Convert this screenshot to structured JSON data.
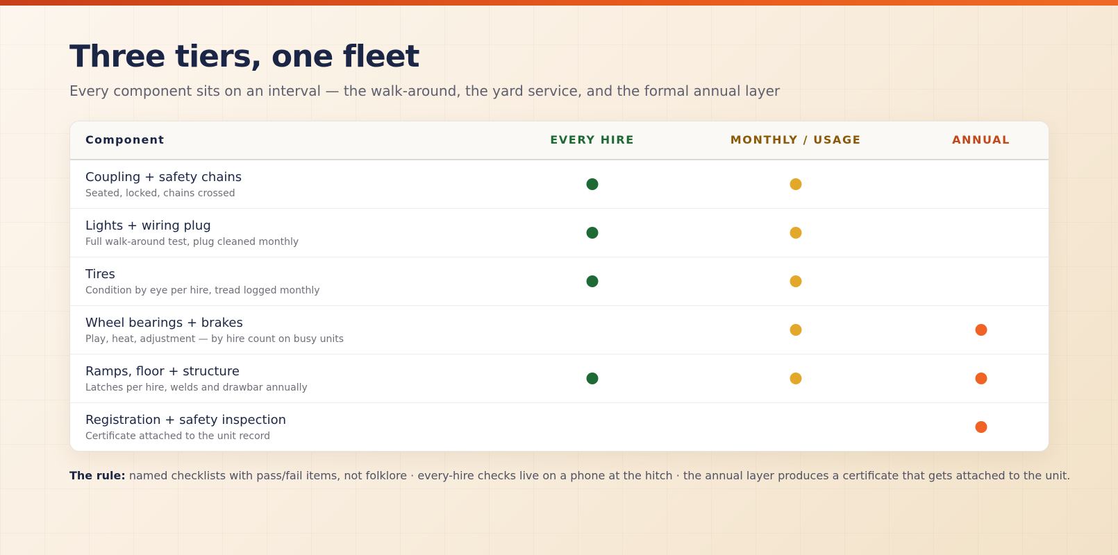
{
  "page": {
    "title": "Three tiers, one fleet",
    "subtitle": "Every component sits on an interval — the walk-around, the yard service, and the formal annual layer"
  },
  "table": {
    "headers": {
      "component": "Component",
      "every_hire": "EVERY HIRE",
      "monthly": "MONTHLY / USAGE",
      "annual": "ANNUAL"
    },
    "colors": {
      "every_hire": "#1d6a35",
      "monthly": "#e3a72a",
      "annual": "#f06325"
    },
    "rows": [
      {
        "title": "Coupling + safety chains",
        "subtitle": "Seated, locked, chains crossed",
        "every_hire": true,
        "monthly": true,
        "annual": false
      },
      {
        "title": "Lights + wiring plug",
        "subtitle": "Full walk-around test, plug cleaned monthly",
        "every_hire": true,
        "monthly": true,
        "annual": false
      },
      {
        "title": "Tires",
        "subtitle": "Condition by eye per hire, tread logged monthly",
        "every_hire": true,
        "monthly": true,
        "annual": false
      },
      {
        "title": "Wheel bearings + brakes",
        "subtitle": "Play, heat, adjustment — by hire count on busy units",
        "every_hire": false,
        "monthly": true,
        "annual": true
      },
      {
        "title": "Ramps, floor + structure",
        "subtitle": "Latches per hire, welds and drawbar annually",
        "every_hire": true,
        "monthly": true,
        "annual": true
      },
      {
        "title": "Registration + safety inspection",
        "subtitle": "Certificate attached to the unit record",
        "every_hire": false,
        "monthly": false,
        "annual": true
      }
    ]
  },
  "footer": {
    "label": "The rule:",
    "text": "named checklists with pass/fail items, not folklore · every-hire checks live on a phone at the hitch · the annual layer produces a certificate that gets attached to the unit."
  }
}
